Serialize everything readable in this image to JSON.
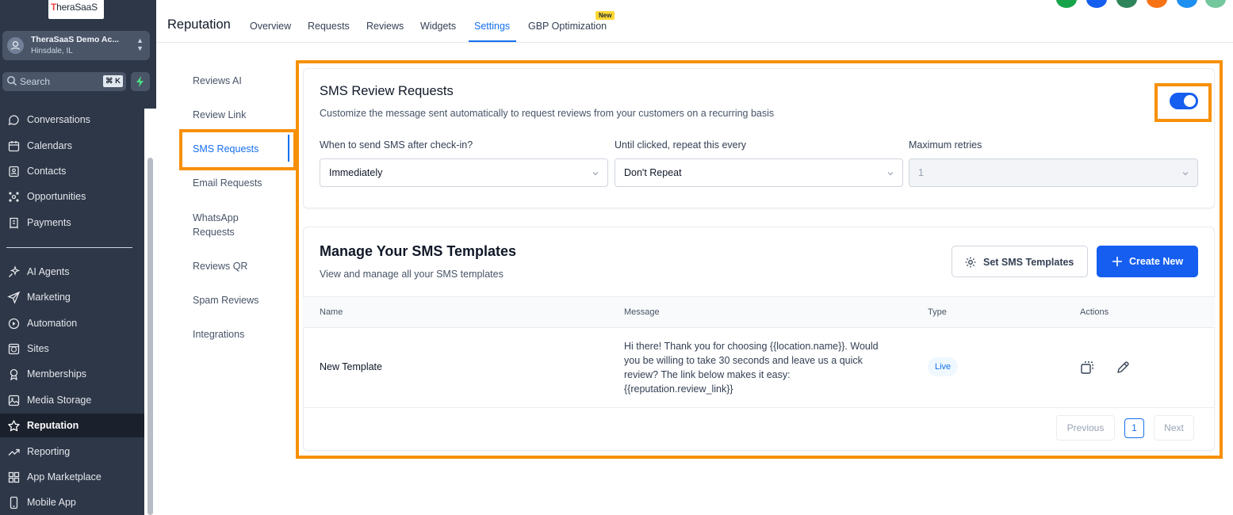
{
  "brand": {
    "logo_prefix": "T",
    "logo_rest": "heraSaaS"
  },
  "account": {
    "name": "TheraSaaS Demo Ac...",
    "location": "Hinsdale, IL"
  },
  "search": {
    "placeholder": "Search",
    "shortcut": "⌘ K"
  },
  "sidebar": {
    "items": [
      {
        "label": "Conversations",
        "icon": "chat-bubble-icon"
      },
      {
        "label": "Calendars",
        "icon": "calendar-icon"
      },
      {
        "label": "Contacts",
        "icon": "contacts-icon"
      },
      {
        "label": "Opportunities",
        "icon": "opportunities-icon"
      },
      {
        "label": "Payments",
        "icon": "payments-icon"
      },
      {
        "label": "AI Agents",
        "icon": "sparkle-icon"
      },
      {
        "label": "Marketing",
        "icon": "send-icon"
      },
      {
        "label": "Automation",
        "icon": "automation-icon"
      },
      {
        "label": "Sites",
        "icon": "globe-icon"
      },
      {
        "label": "Memberships",
        "icon": "award-icon"
      },
      {
        "label": "Media Storage",
        "icon": "image-icon"
      },
      {
        "label": "Reputation",
        "icon": "star-icon"
      },
      {
        "label": "Reporting",
        "icon": "trend-icon"
      },
      {
        "label": "App Marketplace",
        "icon": "grid-icon"
      },
      {
        "label": "Mobile App",
        "icon": "phone-icon"
      }
    ]
  },
  "header": {
    "title": "Reputation",
    "tabs": [
      "Overview",
      "Requests",
      "Reviews",
      "Widgets",
      "Settings",
      "GBP Optimization"
    ],
    "active_tab": "Settings",
    "new_badge": "New",
    "avatar_colors": [
      "#16a34a",
      "#155eef",
      "#2f855a",
      "#f97316",
      "#1d8ff0",
      "#74c69d"
    ]
  },
  "settings_nav": {
    "items": [
      "Reviews AI",
      "Review Link",
      "SMS Requests",
      "Email Requests",
      "WhatsApp Requests",
      "Reviews QR",
      "Spam Reviews",
      "Integrations"
    ],
    "active": "SMS Requests"
  },
  "sms_card": {
    "title": "SMS Review Requests",
    "description": "Customize the message sent automatically to request reviews from your customers on a recurring basis",
    "enabled": true,
    "fields": [
      {
        "label": "When to send SMS after check-in?",
        "value": "Immediately",
        "disabled": false
      },
      {
        "label": "Until clicked, repeat this every",
        "value": "Don't Repeat",
        "disabled": false
      },
      {
        "label": "Maximum retries",
        "value": "1",
        "disabled": true
      }
    ]
  },
  "templates_card": {
    "title": "Manage Your SMS Templates",
    "subtitle": "View and manage all your SMS templates",
    "set_button": "Set SMS Templates",
    "create_button": "Create New",
    "columns": [
      "Name",
      "Message",
      "Type",
      "Actions"
    ],
    "rows": [
      {
        "name": "New Template",
        "message": "Hi there! Thank you for choosing {{location.name}}. Would you be willing to take 30 seconds and leave us a quick review? The link below makes it easy: {{reputation.review_link}}",
        "type": "Live"
      }
    ],
    "pagination": {
      "previous": "Previous",
      "current": "1",
      "next": "Next"
    }
  },
  "colors": {
    "accent": "#155eef",
    "highlight": "#f79009",
    "sidebar_bg": "#2d3748"
  }
}
